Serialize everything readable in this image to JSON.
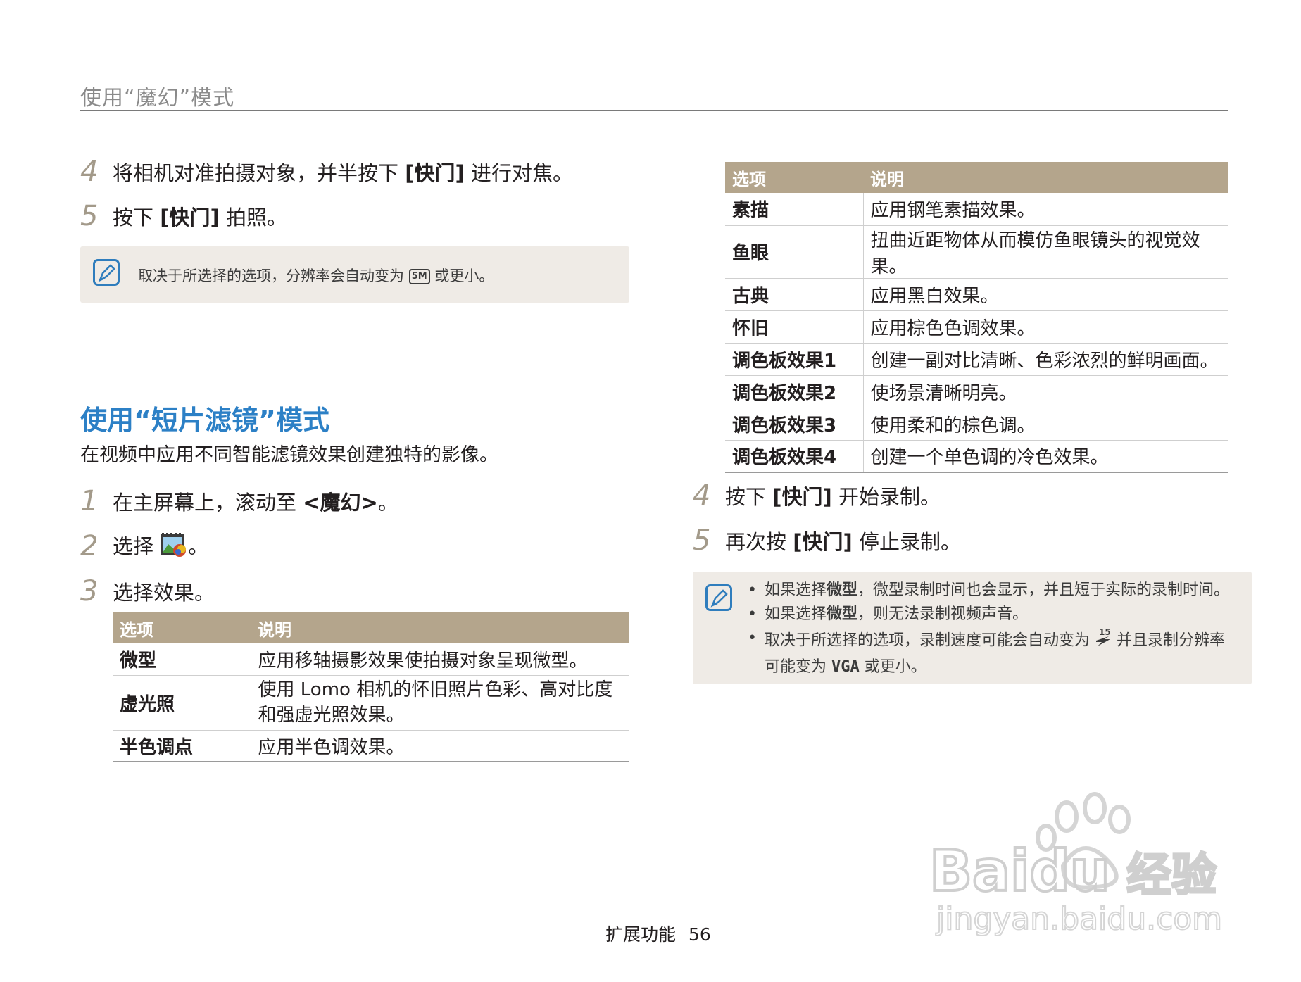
{
  "header": {
    "title": "使用“魔幻”模式"
  },
  "left": {
    "steps_top": [
      {
        "num": "4",
        "pre": "将相机对准拍摄对象，并半按下 ",
        "bold": "[快门]",
        "post": " 进行对焦。"
      },
      {
        "num": "5",
        "pre": "按下 ",
        "bold": "[快门]",
        "post": " 拍照。"
      }
    ],
    "note": {
      "pre": "取决于所选择的选项，分辨率会自动变为 ",
      "icon_text": "5M",
      "post": " 或更小。"
    },
    "section": {
      "title": "使用“短片滤镜”模式",
      "subtitle": "在视频中应用不同智能滤镜效果创建独特的影像。",
      "steps": [
        {
          "num": "1",
          "pre": "在主屏幕上，滚动至 ",
          "bold": "<魔幻>",
          "post": "。"
        },
        {
          "num": "2",
          "pre": "选择 ",
          "post": "。"
        },
        {
          "num": "3",
          "pre": "选择效果。"
        }
      ]
    },
    "table": {
      "headers": [
        "选项",
        "说明"
      ],
      "rows": [
        [
          "微型",
          "应用移轴摄影效果使拍摄对象呈现微型。"
        ],
        [
          "虚光照",
          "使用 Lomo 相机的怀旧照片色彩、高对比度",
          "和强虚光照效果。"
        ],
        [
          "半色调点",
          "应用半色调效果。"
        ]
      ]
    }
  },
  "right": {
    "table": {
      "headers": [
        "选项",
        "说明"
      ],
      "rows": [
        [
          "素描",
          "应用钢笔素描效果。"
        ],
        [
          "鱼眼",
          "扭曲近距物体从而模仿鱼眼镜头的视觉效果。"
        ],
        [
          "古典",
          "应用黑白效果。"
        ],
        [
          "怀旧",
          "应用棕色色调效果。"
        ],
        [
          "调色板效果1",
          "创建一副对比清晰、色彩浓烈的鲜明画面。"
        ],
        [
          "调色板效果2",
          "使场景清晰明亮。"
        ],
        [
          "调色板效果3",
          "使用柔和的棕色调。"
        ],
        [
          "调色板效果4",
          "创建一个单色调的冷色效果。"
        ]
      ]
    },
    "steps": [
      {
        "num": "4",
        "pre": "按下 ",
        "bold": "[快门]",
        "post": " 开始录制。"
      },
      {
        "num": "5",
        "pre": "再次按 ",
        "bold": "[快门]",
        "post": " 停止录制。"
      }
    ],
    "note": {
      "b1": {
        "pre": "如果选择",
        "bold": "微型",
        "post": "，微型录制时间也会显示，并且短于实际的录制时间。"
      },
      "b2": {
        "pre": "如果选择",
        "bold": "微型",
        "post": "，则无法录制视频声音。"
      },
      "b3": {
        "pre": "取决于所选择的选项，录制速度可能会自动变为 ",
        "post": " 并且录制分辨率",
        "line2_pre": "可能变为 ",
        "vga": "VGA",
        "line2_post": " 或更小。"
      }
    }
  },
  "footer": {
    "label": "扩展功能",
    "page": "56"
  },
  "watermark": {
    "brand": "Baidu",
    "cn": "经验",
    "url": "jingyan.baidu.com"
  },
  "colors": {
    "accent": "#2c80c6",
    "table_header": "#b4a58c",
    "note_bg": "#efebe6",
    "step_num": "#a39a8a"
  }
}
